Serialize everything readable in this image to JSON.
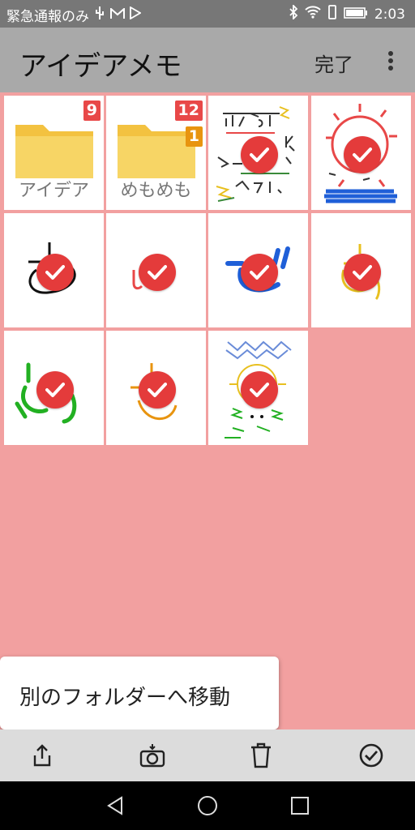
{
  "status_bar": {
    "left_text": "緊急通報のみ",
    "left_icons": [
      "usb-icon",
      "gmail-icon",
      "play-icon"
    ],
    "time": "2:03",
    "right_icons": [
      "bluetooth-icon",
      "wifi-icon",
      "vibrate-icon",
      "battery-icon"
    ]
  },
  "app_bar": {
    "title": "アイデアメモ",
    "done_label": "完了",
    "more_icon": "more-vert-icon"
  },
  "grid": {
    "folders": [
      {
        "name": "アイデア",
        "count": "9",
        "count_color": "#e84848"
      },
      {
        "name": "めもめも",
        "count": "12",
        "count_color": "#e84848",
        "sub_count": "1",
        "sub_count_color": "#e8940f"
      }
    ],
    "note_count": 9,
    "selected_icon": "check-circle-icon",
    "selected_color": "#e43b3b"
  },
  "context_menu": {
    "move_label": "別のフォルダーへ移動"
  },
  "toolbar": {
    "icons": [
      "share-icon",
      "camera-icon",
      "trash-icon",
      "check-circle-icon"
    ]
  },
  "nav_bar": {
    "icons": [
      "back-icon",
      "home-icon",
      "recents-icon"
    ]
  }
}
